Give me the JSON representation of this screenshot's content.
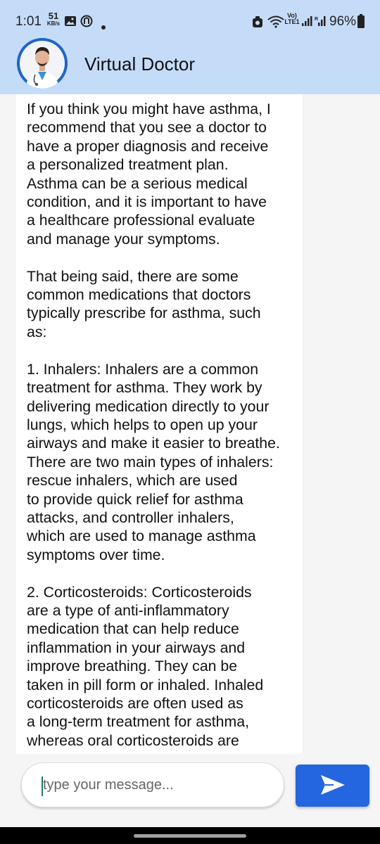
{
  "status_bar": {
    "time": "1:01",
    "data_rate_value": "51",
    "data_rate_unit": "KB/s",
    "network_label": "Vo) LTE1",
    "battery": "96%",
    "icons": [
      "gallery-icon",
      "app-icon",
      "dot-icon",
      "screenshot-icon",
      "wifi-icon",
      "signal-icon",
      "signal-roaming-icon",
      "battery-icon"
    ]
  },
  "header": {
    "title": "Virtual Doctor",
    "avatar": "doctor-avatar"
  },
  "chat": {
    "message": "If you think you might have asthma, I\nrecommend that you see a doctor to\nhave a proper diagnosis and receive\na personalized treatment plan.\nAsthma can be a serious medical\ncondition, and it is important to have\na healthcare professional evaluate\nand manage your symptoms.\n\nThat being said, there are some\ncommon medications that doctors\ntypically prescribe for asthma, such\nas:\n\n1. Inhalers: Inhalers are a common\ntreatment for asthma. They work by\ndelivering medication directly to your\nlungs, which helps to open up your\nairways and make it easier to breathe.\nThere are two main types of inhalers:\nrescue inhalers, which are used\nto provide quick relief for asthma\nattacks, and controller inhalers,\nwhich are used to manage asthma\nsymptoms over time.\n\n2. Corticosteroids: Corticosteroids\nare a type of anti-inflammatory\nmedication that can help reduce\ninflammation in your airways and\nimprove breathing. They can be\ntaken in pill form or inhaled. Inhaled\ncorticosteroids are often used as\na long-term treatment for asthma,\nwhereas oral corticosteroids are"
  },
  "composer": {
    "placeholder": "type your message...",
    "value": "",
    "send_icon": "send-icon"
  },
  "colors": {
    "header_bg": "#c5dcf9",
    "accent": "#2465e0",
    "background": "#f5f5f5"
  }
}
